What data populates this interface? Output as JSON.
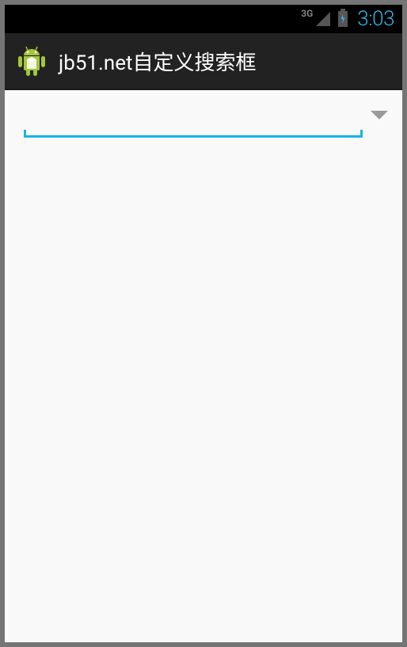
{
  "status_bar": {
    "network_label": "3G",
    "time": "3:03"
  },
  "app_bar": {
    "title": "jb51.net自定义搜索框"
  },
  "search": {
    "value": "",
    "placeholder": ""
  }
}
